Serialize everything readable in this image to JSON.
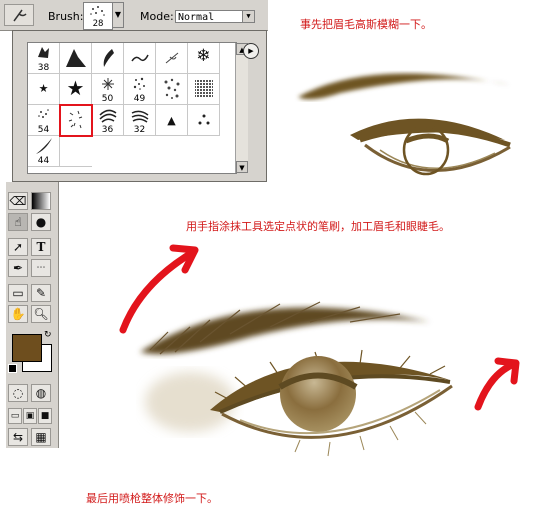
{
  "toolbar": {
    "brush_label": "Brush:",
    "brush_size": "28",
    "mode_label": "Mode:",
    "mode_value": "Normal"
  },
  "brush_picker": {
    "sizes": [
      "38",
      "",
      "",
      "",
      "",
      "",
      "",
      "",
      "50",
      "49",
      "",
      "",
      "54",
      "",
      "36",
      "32",
      "",
      "",
      "44"
    ]
  },
  "annotations": {
    "step1": "事先把眉毛高斯模糊一下。",
    "step2": "用手指涂抹工具选定点状的笔刷，加工眉毛和眼睫毛。",
    "step3": "最后用喷枪整体修饰一下。"
  },
  "colors": {
    "accent_red": "#e3141c",
    "foreground": "#6e4e1e",
    "background": "#ffffff",
    "eye_brown": "#7a5a2a"
  },
  "icons": [
    "tool-preset-icon",
    "brush-menu-icon",
    "eraser-icon",
    "gradient-icon",
    "smudge-icon",
    "dodge-icon",
    "move-icon",
    "type-icon",
    "pen-icon",
    "shape-icon",
    "notes-icon",
    "eyedropper-icon",
    "hand-icon",
    "zoom-icon",
    "swap-colors-icon"
  ]
}
